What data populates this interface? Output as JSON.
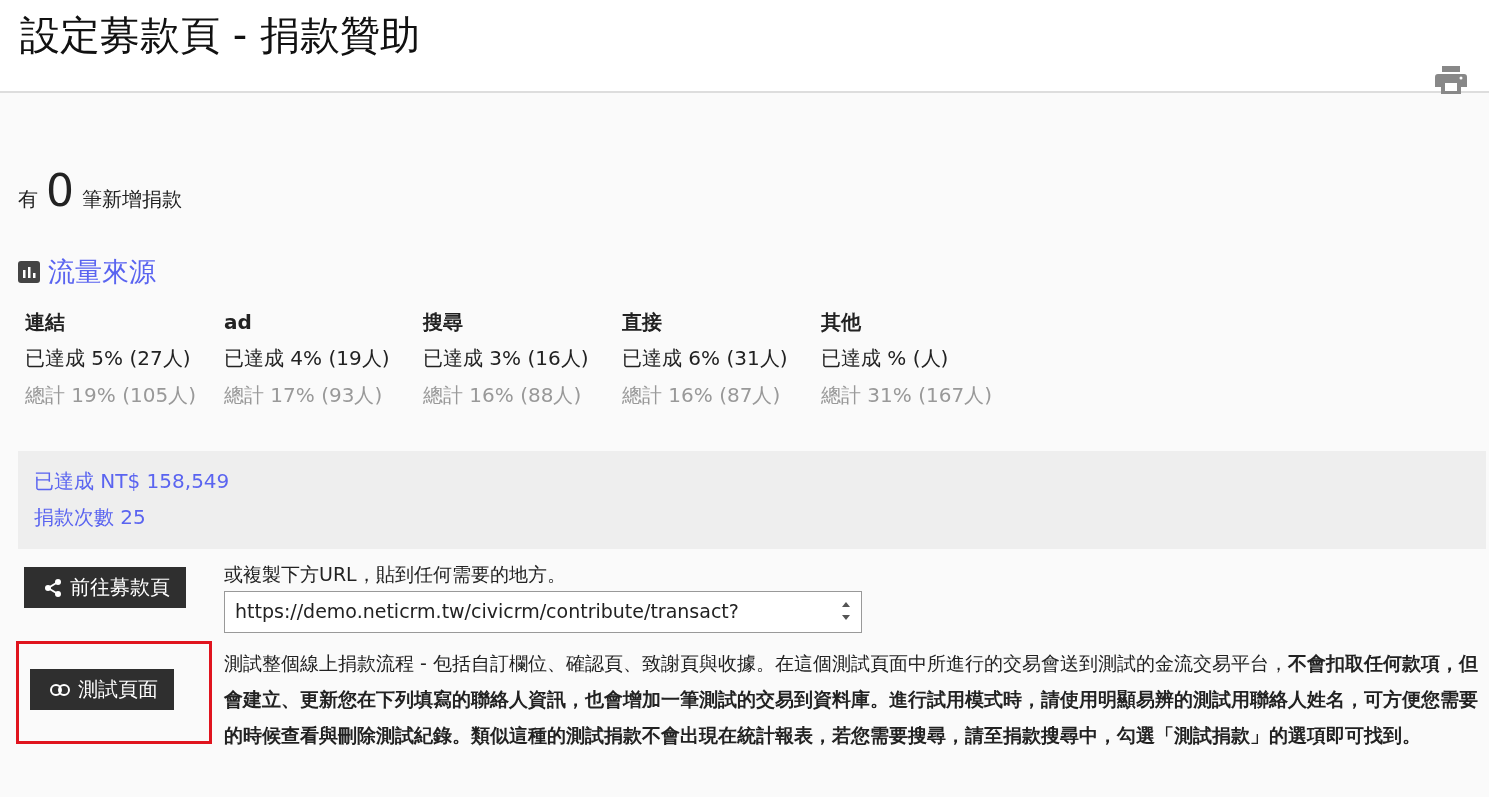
{
  "header": {
    "title": "設定募款頁 - 捐款贊助"
  },
  "new_count": {
    "prefix": "有",
    "count": "0",
    "suffix": "筆新增捐款"
  },
  "traffic": {
    "title": "流量來源",
    "sources": [
      {
        "name": "連結",
        "achieved": "已達成 5% (27人)",
        "total": "總計 19% (105人)"
      },
      {
        "name": "ad",
        "achieved": "已達成 4% (19人)",
        "total": "總計 17% (93人)"
      },
      {
        "name": "搜尋",
        "achieved": "已達成 3% (16人)",
        "total": "總計 16% (88人)"
      },
      {
        "name": "直接",
        "achieved": "已達成 6% (31人)",
        "total": "總計 16% (87人)"
      },
      {
        "name": "其他",
        "achieved": "已達成 % (人)",
        "total": "總計 31% (167人)"
      }
    ]
  },
  "summary": [
    "已達成 NT$ 158,549",
    "捐款次數 25"
  ],
  "share": {
    "button": "前往募款頁",
    "hint": "或複製下方URL，貼到任何需要的地方。",
    "url": "https://demo.neticrm.tw/civicrm/contribute/transact?"
  },
  "test": {
    "button": "測試頁面",
    "highlighted": true,
    "description": "測試整個線上捐款流程 - 包括自訂欄位、確認頁、致謝頁與收據。在這個測試頁面中所進行的交易會送到測試的金流交易平台，**不會扣取任何款項，但會建立、更新您在下列填寫的聯絡人資訊，也會增加一筆測試的交易到資料庫。進行試用模式時，請使用明顯易辨的測試用聯絡人姓名，可方便您需要的時候查看與刪除測試紀錄。類似這種的測試捐款不會出現在統計報表，若您需要搜尋，請至捐款搜尋中，勾選「測試捐款」的選項即可找到。**"
  }
}
